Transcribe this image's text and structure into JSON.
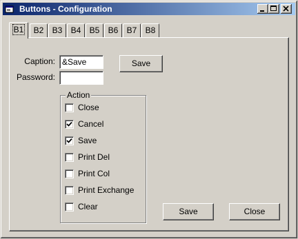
{
  "window": {
    "title": "Buttons - Configuration",
    "controls": [
      "minimize-icon",
      "maximize-icon",
      "close-icon"
    ],
    "titlebar_colors": [
      "#0a246a",
      "#a6caf0"
    ]
  },
  "tabs": [
    {
      "label": "B1",
      "active": true
    },
    {
      "label": "B2",
      "active": false
    },
    {
      "label": "B3",
      "active": false
    },
    {
      "label": "B4",
      "active": false
    },
    {
      "label": "B5",
      "active": false
    },
    {
      "label": "B6",
      "active": false
    },
    {
      "label": "B7",
      "active": false
    },
    {
      "label": "B8",
      "active": false
    }
  ],
  "form": {
    "caption_label": "Caption:",
    "caption_value": "&Save",
    "password_label": "Password:",
    "password_value": "",
    "preview_button_label": "Save"
  },
  "action_group": {
    "legend": "Action",
    "options": [
      {
        "label": "Close",
        "checked": false
      },
      {
        "label": "Cancel",
        "checked": true
      },
      {
        "label": "Save",
        "checked": true
      },
      {
        "label": "Print Del",
        "checked": false
      },
      {
        "label": "Print Col",
        "checked": false
      },
      {
        "label": "Print Exchange",
        "checked": false
      },
      {
        "label": "Clear",
        "checked": false
      }
    ]
  },
  "footer": {
    "save_label": "Save",
    "close_label": "Close"
  }
}
